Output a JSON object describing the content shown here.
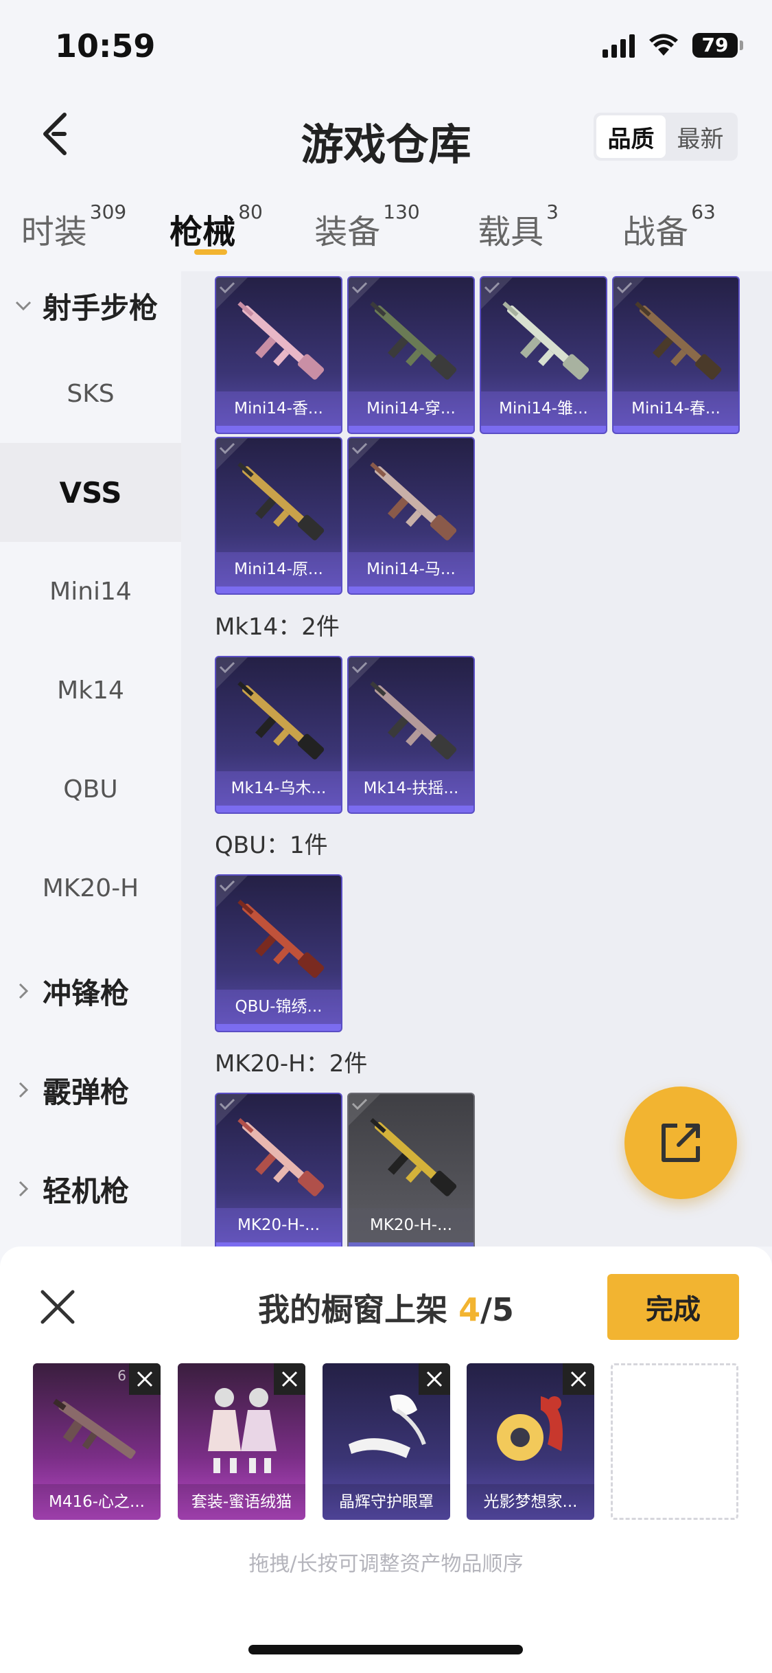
{
  "status": {
    "time": "10:59",
    "battery": "79"
  },
  "header": {
    "title": "游戏仓库",
    "sort_options": [
      "品质",
      "最新"
    ],
    "sort_active": "品质"
  },
  "tabs": [
    {
      "label": "时装",
      "count": "309"
    },
    {
      "label": "枪械",
      "count": "80",
      "active": true
    },
    {
      "label": "装备",
      "count": "130"
    },
    {
      "label": "载具",
      "count": "3"
    },
    {
      "label": "战备",
      "count": "63"
    }
  ],
  "sidebar": {
    "group_open": "射手步枪",
    "items": [
      "SKS",
      "VSS",
      "Mini14",
      "Mk14",
      "QBU",
      "MK20-H"
    ],
    "active_item": "VSS",
    "groups_closed": [
      "冲锋枪",
      "霰弹枪",
      "轻机枪"
    ]
  },
  "mini14_cards": [
    "Mini14-香...",
    "Mini14-穿...",
    "Mini14-雏...",
    "Mini14-春...",
    "Mini14-原...",
    "Mini14-马..."
  ],
  "mk14_section": {
    "title": "Mk14：2件",
    "cards": [
      "Mk14-乌木...",
      "Mk14-扶摇..."
    ]
  },
  "qbu_section": {
    "title": "QBU：1件",
    "cards": [
      "QBU-锦绣..."
    ]
  },
  "mk20_section": {
    "title": "MK20-H：2件",
    "cards": [
      "MK20-H-...",
      "MK20-H-..."
    ]
  },
  "showcase": {
    "title_prefix": "我的橱窗上架 ",
    "count_current": "4",
    "count_total": "/5",
    "done_label": "完成",
    "slots": [
      {
        "name": "M416-心之...",
        "corner": "6"
      },
      {
        "name": "套装-蜜语绒猫"
      },
      {
        "name": "晶辉守护眼罩"
      },
      {
        "name": "光影梦想家..."
      }
    ],
    "hint": "拖拽/长按可调整资产物品顺序"
  },
  "colors": {
    "accent": "#f2b431",
    "card_border": "#5a4ec4",
    "card_bar": "#7b6cf0"
  }
}
